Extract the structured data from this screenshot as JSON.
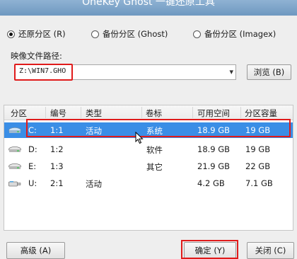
{
  "window": {
    "title": "OneKey Ghost 一键还原工具"
  },
  "modes": [
    {
      "label": "还原分区 (R)",
      "selected": true
    },
    {
      "label": "备份分区 (Ghost)",
      "selected": false
    },
    {
      "label": "备份分区 (Imagex)",
      "selected": false
    }
  ],
  "image_path": {
    "label": "映像文件路径:",
    "value": "Z:\\WIN7.GHO",
    "browse_label": "浏览 (B)"
  },
  "table": {
    "columns": [
      "分区",
      "编号",
      "类型",
      "卷标",
      "可用空间",
      "分区容量"
    ],
    "rows": [
      {
        "drive": "C:",
        "number": "1:1",
        "type": "活动",
        "volume": "系统",
        "free": "18.9 GB",
        "size": "19 GB",
        "selected": true,
        "icon": "hard-disk-icon"
      },
      {
        "drive": "D:",
        "number": "1:2",
        "type": "",
        "volume": "软件",
        "free": "18.9 GB",
        "size": "19 GB",
        "selected": false,
        "icon": "hard-disk-icon"
      },
      {
        "drive": "E:",
        "number": "1:3",
        "type": "",
        "volume": "其它",
        "free": "21.9 GB",
        "size": "22 GB",
        "selected": false,
        "icon": "hard-disk-icon"
      },
      {
        "drive": "U:",
        "number": "2:1",
        "type": "活动",
        "volume": "",
        "free": "4.2 GB",
        "size": "7.1 GB",
        "selected": false,
        "icon": "usb-drive-icon"
      }
    ]
  },
  "footer": {
    "advanced_label": "高级 (A)",
    "ok_label": "确定 (Y)",
    "close_label": "关闭 (C)"
  },
  "colors": {
    "selection": "#3a8ee6",
    "highlight_box": "#e01b1b"
  }
}
